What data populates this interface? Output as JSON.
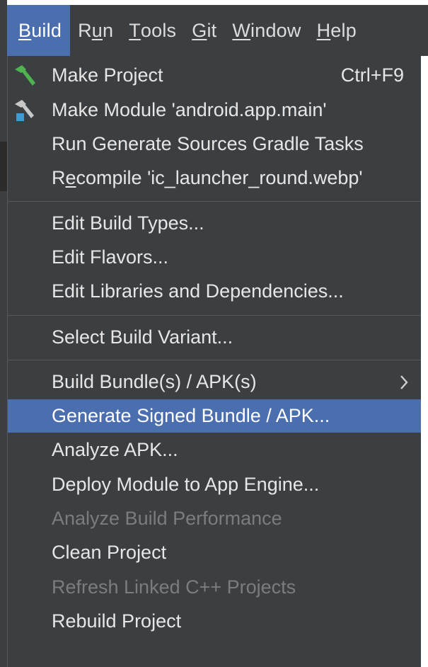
{
  "menubar": {
    "items": [
      {
        "mnemonic": "B",
        "rest": "uild"
      },
      {
        "mnemonic": "R",
        "mnemonic_pos": 1,
        "pre": "R",
        "mn": "u",
        "post": "n"
      },
      {
        "mnemonic": "T",
        "rest": "ools"
      },
      {
        "mnemonic": "G",
        "rest": "it"
      },
      {
        "mnemonic": "W",
        "rest": "indow"
      },
      {
        "mnemonic": "H",
        "rest": "elp"
      }
    ]
  },
  "build_menu": {
    "make_project": {
      "label": "Make Project",
      "shortcut": "Ctrl+F9",
      "icon": "hammer-icon"
    },
    "make_module": {
      "label": "Make Module 'android.app.main'",
      "icon": "hammer-module-icon"
    },
    "run_generate": {
      "label": "Run Generate Sources Gradle Tasks"
    },
    "recompile": {
      "pre": "R",
      "mn": "e",
      "post": "compile 'ic_launcher_round.webp'"
    },
    "edit_build_types": {
      "label": "Edit Build Types..."
    },
    "edit_flavors": {
      "label": "Edit Flavors..."
    },
    "edit_libraries": {
      "label": "Edit Libraries and Dependencies..."
    },
    "select_variant": {
      "label": "Select Build Variant..."
    },
    "build_bundle": {
      "label": "Build Bundle(s) / APK(s)",
      "icon": "chevron-right-icon"
    },
    "generate_signed": {
      "label": "Generate Signed Bundle / APK..."
    },
    "analyze_apk": {
      "label": "Analyze APK..."
    },
    "deploy_module": {
      "label": "Deploy Module to App Engine..."
    },
    "analyze_build_perf": {
      "label": "Analyze Build Performance"
    },
    "clean_project": {
      "label": "Clean Project"
    },
    "refresh_linked": {
      "label": "Refresh Linked C++ Projects"
    },
    "rebuild_project": {
      "label": "Rebuild Project"
    }
  },
  "colors": {
    "menu_bg": "#3c3f41",
    "selection": "#4b6eaf",
    "text": "#e6e6e6",
    "disabled_text": "#7a7d80"
  }
}
